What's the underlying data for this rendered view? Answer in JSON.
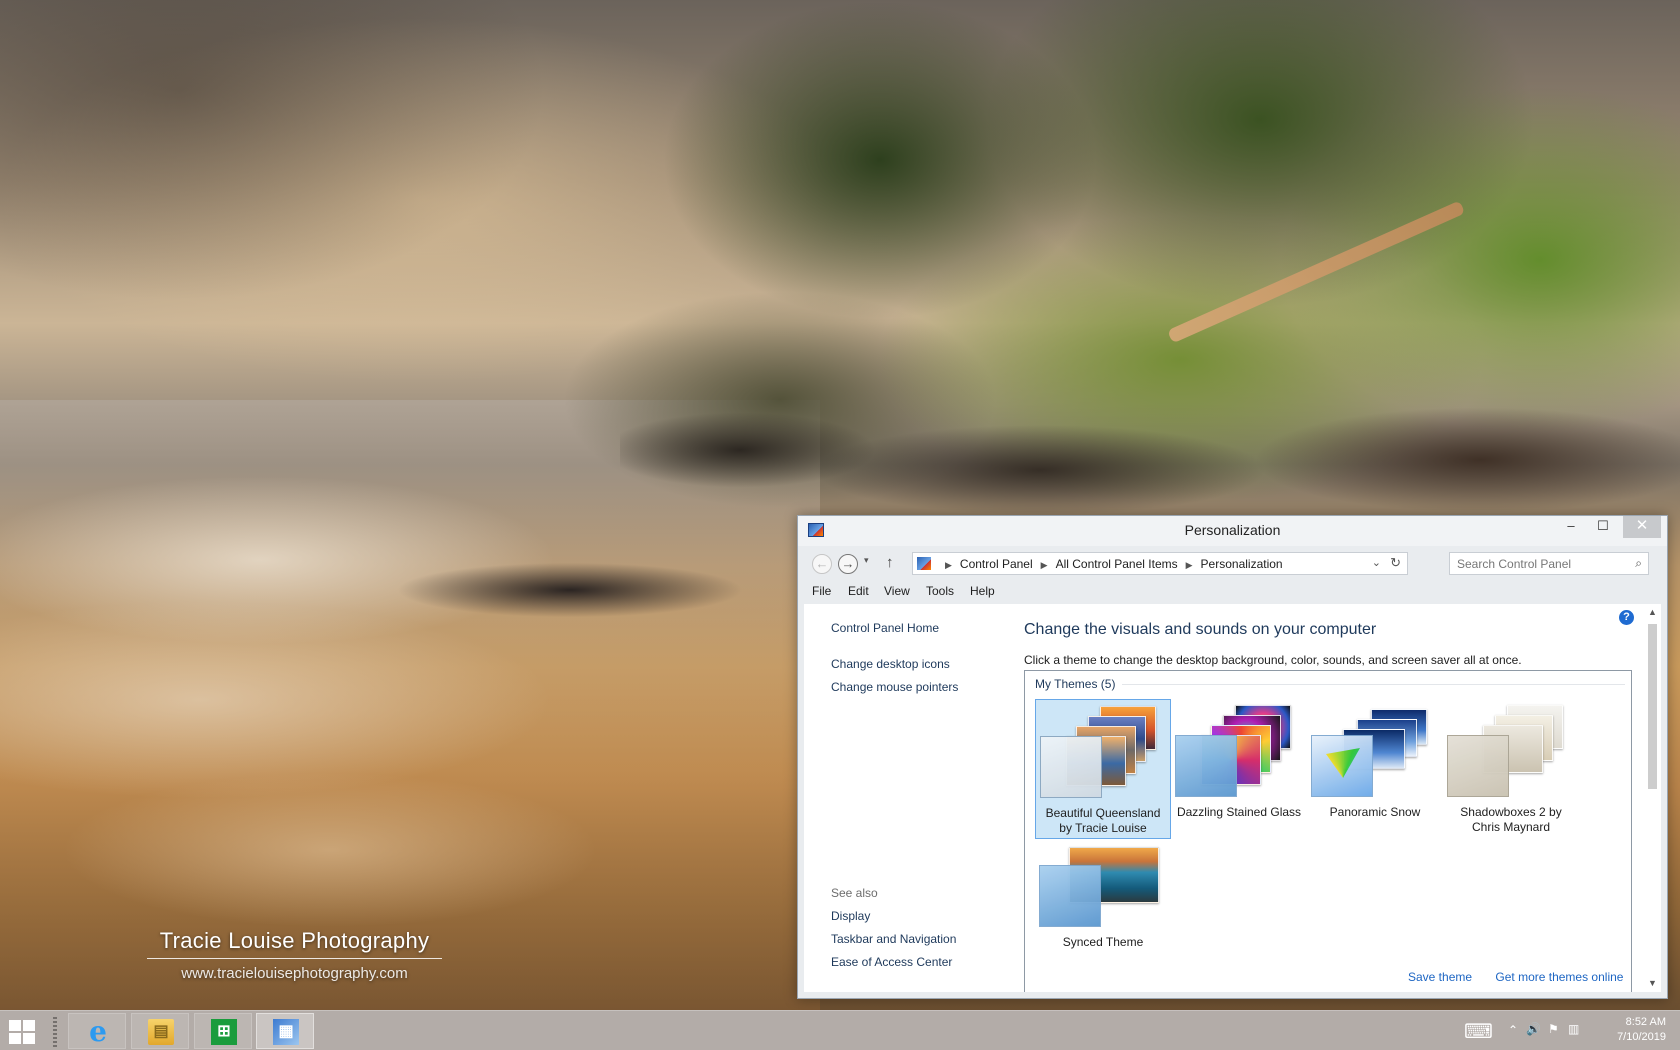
{
  "desktop": {
    "watermark_title": "Tracie Louise Photography",
    "watermark_url": "www.tracielouisephotography.com"
  },
  "window": {
    "title": "Personalization",
    "controls": {
      "minimize": "–",
      "maximize": "☐",
      "close": "✕"
    },
    "nav": {
      "back": "←",
      "forward": "→",
      "recent": "▾",
      "up": "↑",
      "breadcrumbs": [
        "Control Panel",
        "All Control Panel Items",
        "Personalization"
      ],
      "dropdown": "⌄",
      "refresh": "↻",
      "search_placeholder": "Search Control Panel",
      "search_icon": "⌕"
    },
    "menu": [
      "File",
      "Edit",
      "View",
      "Tools",
      "Help"
    ],
    "left_pane": {
      "home": "Control Panel Home",
      "links": [
        "Change desktop icons",
        "Change mouse pointers"
      ],
      "see_also_heading": "See also",
      "see_also": [
        "Display",
        "Taskbar and Navigation",
        "Ease of Access Center"
      ]
    },
    "main": {
      "help": "?",
      "title": "Change the visuals and sounds on your computer",
      "description": "Click a theme to change the desktop background, color, sounds, and screen saver all at once.",
      "group_label": "My Themes (5)",
      "themes": [
        {
          "line1": "Beautiful Queensland",
          "line2": "by Tracie Louise",
          "selected": true
        },
        {
          "line1": "Dazzling Stained Glass",
          "line2": ""
        },
        {
          "line1": "Panoramic Snow",
          "line2": ""
        },
        {
          "line1": "Shadowboxes 2 by",
          "line2": "Chris Maynard"
        },
        {
          "line1": "Synced Theme",
          "line2": ""
        }
      ],
      "footer_links": [
        "Save theme",
        "Get more themes online"
      ],
      "scroll_up": "▲",
      "scroll_down": "▼"
    }
  },
  "taskbar": {
    "apps": [
      {
        "name": "Internet Explorer",
        "icon": "internet-explorer-icon",
        "glyph": "e"
      },
      {
        "name": "File Explorer",
        "icon": "file-explorer-icon",
        "glyph": "▤"
      },
      {
        "name": "Store",
        "icon": "store-icon",
        "glyph": "⊞"
      },
      {
        "name": "Control Panel",
        "icon": "control-panel-icon",
        "glyph": "▦"
      }
    ],
    "tray": {
      "keyboard": "⌨",
      "chevron": "⌃",
      "volume": "🔊",
      "flag": "⚑",
      "network": "▥"
    },
    "time": "8:52 AM",
    "date": "7/10/2019"
  },
  "colors": {
    "link": "#1e395b",
    "footer_link": "#1e66c3",
    "selection": "#cde6f7",
    "store_green": "#1a9c3c",
    "ie_blue": "#1e88e5"
  }
}
